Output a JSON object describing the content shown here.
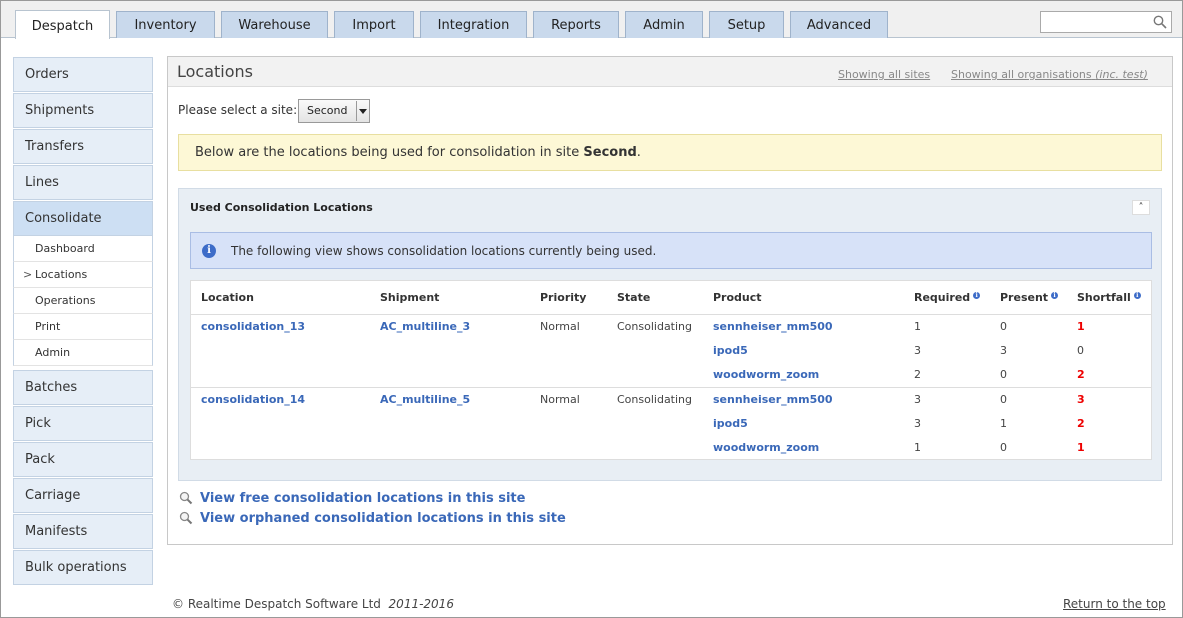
{
  "tabs": [
    {
      "label": "Despatch",
      "active": true
    },
    {
      "label": "Inventory"
    },
    {
      "label": "Warehouse"
    },
    {
      "label": "Import"
    },
    {
      "label": "Integration"
    },
    {
      "label": "Reports"
    },
    {
      "label": "Admin"
    },
    {
      "label": "Setup"
    },
    {
      "label": "Advanced"
    }
  ],
  "search": {
    "placeholder": "",
    "value": ""
  },
  "sidebar": {
    "items": [
      {
        "label": "Orders"
      },
      {
        "label": "Shipments"
      },
      {
        "label": "Transfers"
      },
      {
        "label": "Lines"
      },
      {
        "label": "Consolidate",
        "active": true
      },
      {
        "label": "Batches"
      },
      {
        "label": "Pick"
      },
      {
        "label": "Pack"
      },
      {
        "label": "Carriage"
      },
      {
        "label": "Manifests"
      },
      {
        "label": "Bulk operations"
      }
    ],
    "subitems": [
      {
        "label": "Dashboard"
      },
      {
        "label": "Locations",
        "current": true
      },
      {
        "label": "Operations"
      },
      {
        "label": "Print"
      },
      {
        "label": "Admin"
      }
    ]
  },
  "main": {
    "title": "Locations",
    "showing_sites": "Showing all sites",
    "showing_orgs": "Showing all organisations",
    "showing_orgs_suffix": "(inc. test)",
    "site_label": "Please select a site:",
    "site_value": "Second",
    "notice_prefix": "Below are the locations being used for consolidation in site",
    "notice_site": "Second",
    "notice_suffix": "."
  },
  "box": {
    "title": "Used Consolidation Locations",
    "info": "The following view shows consolidation locations currently being used.",
    "columns": [
      "Location",
      "Shipment",
      "Priority",
      "State",
      "Product",
      "Required",
      "Present",
      "Shortfall"
    ],
    "groups": [
      {
        "location": "consolidation_13",
        "shipment": "AC_multiline_3",
        "priority": "Normal",
        "state": "Consolidating",
        "lines": [
          {
            "product": "sennheiser_mm500",
            "required": "1",
            "present": "0",
            "shortfall": "1"
          },
          {
            "product": "ipod5",
            "required": "3",
            "present": "3",
            "shortfall": "0"
          },
          {
            "product": "woodworm_zoom",
            "required": "2",
            "present": "0",
            "shortfall": "2"
          }
        ]
      },
      {
        "location": "consolidation_14",
        "shipment": "AC_multiline_5",
        "priority": "Normal",
        "state": "Consolidating",
        "lines": [
          {
            "product": "sennheiser_mm500",
            "required": "3",
            "present": "0",
            "shortfall": "3"
          },
          {
            "product": "ipod5",
            "required": "3",
            "present": "1",
            "shortfall": "2"
          },
          {
            "product": "woodworm_zoom",
            "required": "1",
            "present": "0",
            "shortfall": "1"
          }
        ]
      }
    ]
  },
  "links": {
    "free": "View free consolidation locations in this site",
    "orphaned": "View orphaned consolidation locations in this site"
  },
  "footer": {
    "copyright": "© Realtime Despatch Software Ltd",
    "years": "2011-2016",
    "to_top": "Return to the top"
  },
  "colors": {
    "link": "#3a68b8",
    "shortfall": "#e00000",
    "tab": "#c9d9ec"
  }
}
